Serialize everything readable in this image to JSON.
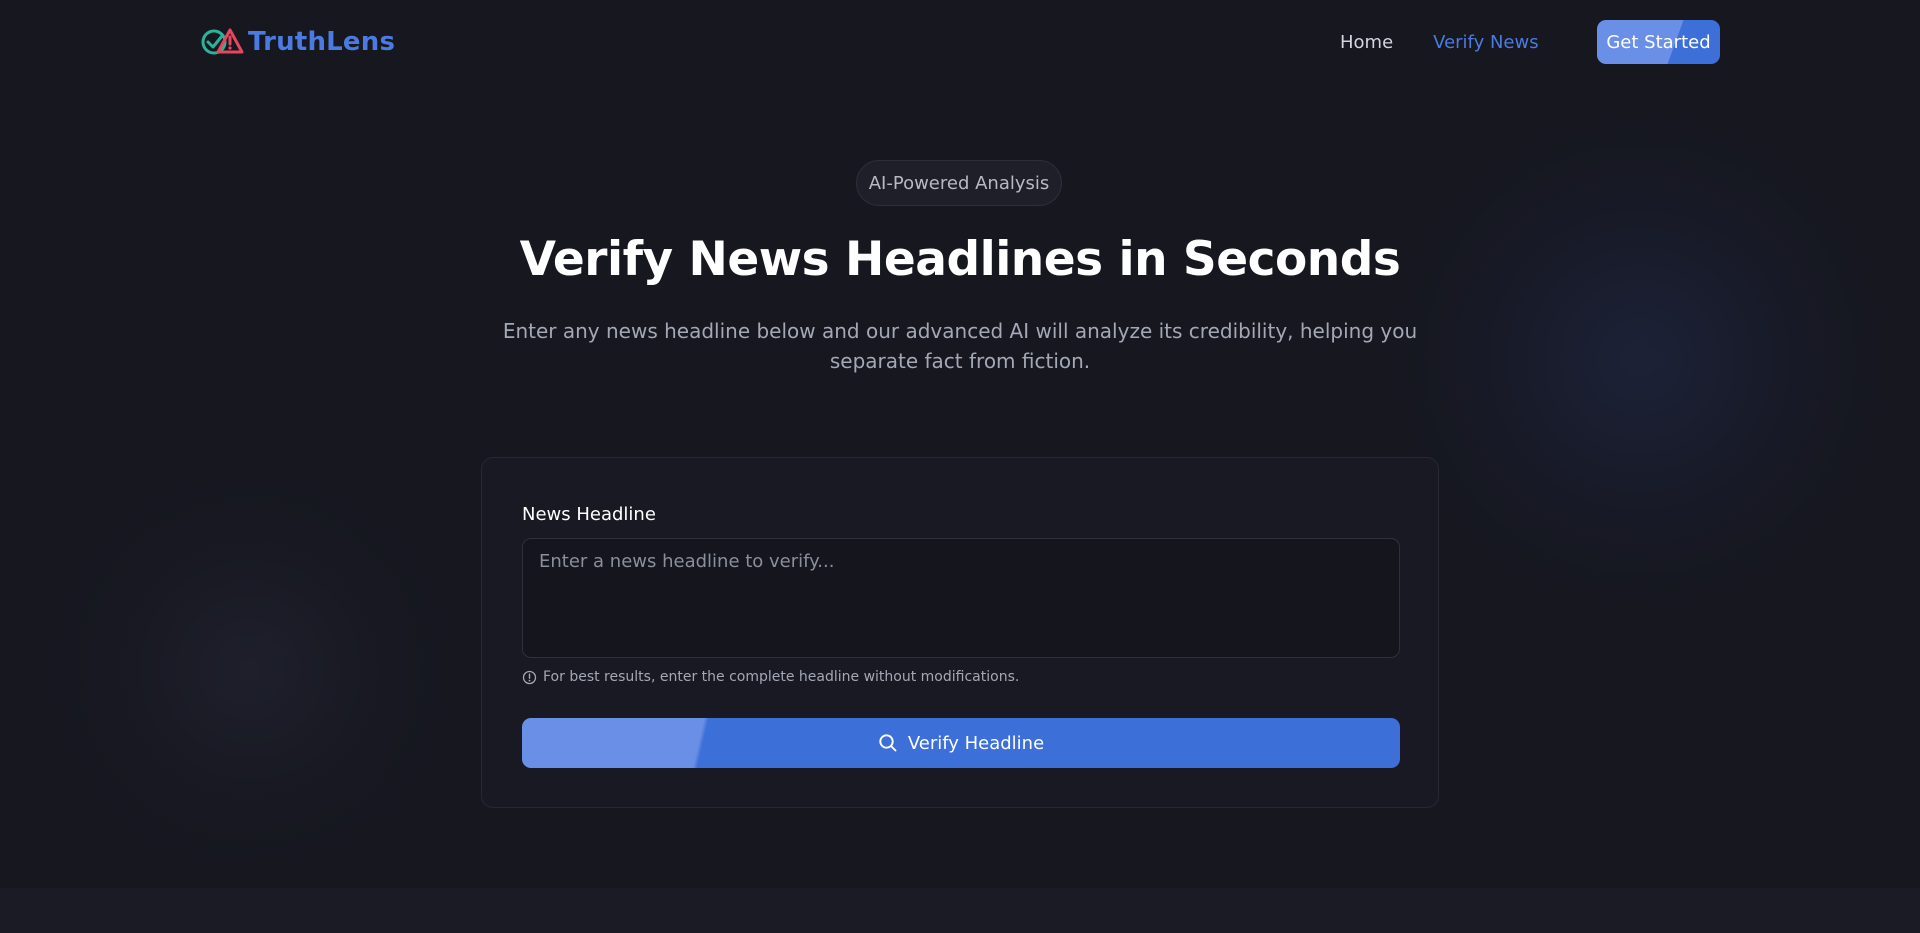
{
  "brand": {
    "name": "TruthLens",
    "logo_icon": "check-alert-logo-icon",
    "accent_color": "#4b7be0"
  },
  "nav": {
    "items": [
      {
        "label": "Home",
        "active": false
      },
      {
        "label": "Verify News",
        "active": true
      }
    ],
    "cta_label": "Get Started"
  },
  "hero": {
    "badge": "AI-Powered Analysis",
    "title": "Verify News Headlines in Seconds",
    "subtitle": "Enter any news headline below and our advanced AI will analyze its credibility, helping you separate fact from fiction."
  },
  "form": {
    "label": "News Headline",
    "value": "",
    "placeholder": "Enter a news headline to verify...",
    "hint_icon": "info-circle-icon",
    "hint": "For best results, enter the complete headline without modifications.",
    "submit_icon": "search-icon",
    "submit_label": "Verify Headline"
  },
  "colors": {
    "background": "#16171f",
    "card": "#181922",
    "button_primary": "#3c6fd8",
    "button_highlight": "#6a8fe6"
  }
}
